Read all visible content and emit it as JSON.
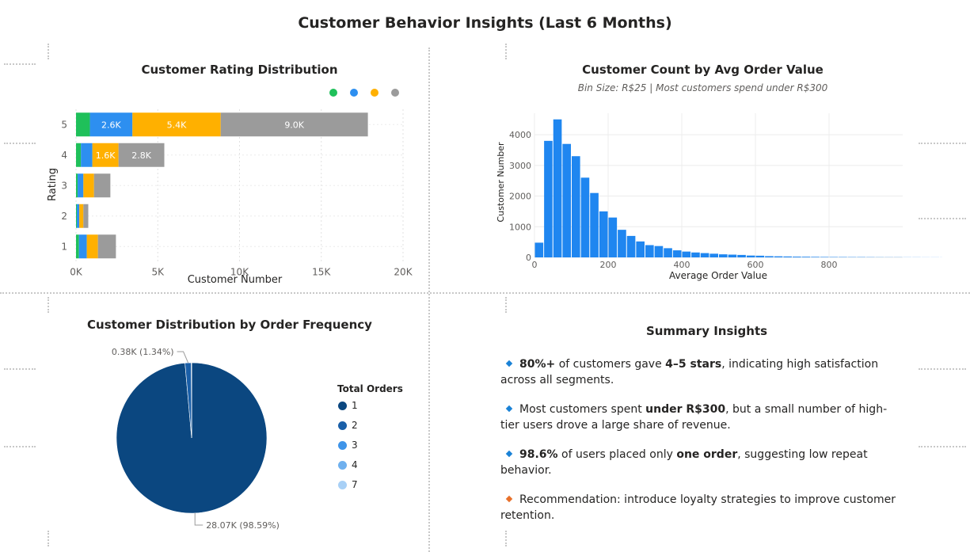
{
  "page": {
    "title": "Customer Behavior Insights (Last 6 Months)"
  },
  "rating_chart": {
    "title": "Customer Rating Distribution",
    "xlabel": "Customer Number",
    "ylabel": "Rating",
    "legend_colors": [
      "#1fc05a",
      "#2d8ff0",
      "#ffb000",
      "#9b9b9b"
    ]
  },
  "histogram": {
    "title": "Customer Count by Avg Order Value",
    "subtitle": "Bin Size: R$25 | Most customers spend under R$300",
    "xlabel": "Average Order Value",
    "ylabel": "Customer Number"
  },
  "pie_chart": {
    "title": "Customer Distribution by Order Frequency",
    "legend_title": "Total Orders",
    "legend": [
      {
        "label": "1",
        "color": "#0b4780"
      },
      {
        "label": "2",
        "color": "#1a5fa8"
      },
      {
        "label": "3",
        "color": "#3f94e8"
      },
      {
        "label": "4",
        "color": "#6fb0ee"
      },
      {
        "label": "7",
        "color": "#a8d0f6"
      }
    ],
    "label_small": "0.38K (1.34%)",
    "label_large": "28.07K (98.59%)"
  },
  "summary": {
    "title": "Summary Insights",
    "insights": [
      {
        "color": "#1a82d6",
        "parts": [
          {
            "t": "80%+",
            "b": true
          },
          {
            "t": " of customers gave ",
            "b": false
          },
          {
            "t": "4–5 stars",
            "b": true
          },
          {
            "t": ", indicating high satisfaction across all segments.",
            "b": false
          }
        ]
      },
      {
        "color": "#1a82d6",
        "parts": [
          {
            "t": "Most customers spent ",
            "b": false
          },
          {
            "t": "under R$300",
            "b": true
          },
          {
            "t": ", but a small number of high-tier users drove a large share of revenue.",
            "b": false
          }
        ]
      },
      {
        "color": "#1a82d6",
        "parts": [
          {
            "t": "98.6%",
            "b": true
          },
          {
            "t": " of users placed only ",
            "b": false
          },
          {
            "t": "one order",
            "b": true
          },
          {
            "t": ", suggesting low repeat behavior.",
            "b": false
          }
        ]
      },
      {
        "color": "#e8702a",
        "parts": [
          {
            "t": "Recommendation: introduce loyalty strategies to improve customer retention.",
            "b": false
          }
        ]
      }
    ]
  },
  "chart_data": [
    {
      "type": "bar",
      "orientation": "horizontal",
      "stacked": true,
      "title": "Customer Rating Distribution",
      "xlabel": "Customer Number",
      "ylabel": "Rating",
      "categories": [
        "5",
        "4",
        "3",
        "2",
        "1"
      ],
      "xlim": [
        0,
        20000
      ],
      "xticks": [
        {
          "value": 0,
          "label": "0K"
        },
        {
          "value": 5000,
          "label": "5K"
        },
        {
          "value": 10000,
          "label": "10K"
        },
        {
          "value": 15000,
          "label": "15K"
        },
        {
          "value": 20000,
          "label": "20K"
        }
      ],
      "series": [
        {
          "color": "#1fc05a",
          "values": [
            850,
            300,
            100,
            50,
            180
          ]
        },
        {
          "color": "#2d8ff0",
          "values": [
            2600,
            700,
            350,
            150,
            480
          ]
        },
        {
          "color": "#ffb000",
          "values": [
            5400,
            1600,
            650,
            250,
            680
          ]
        },
        {
          "color": "#9b9b9b",
          "values": [
            9000,
            2800,
            1000,
            300,
            1100
          ]
        }
      ],
      "data_labels": [
        [
          "",
          "2.6K",
          "5.4K",
          "9.0K"
        ],
        [
          "",
          "",
          "1.6K",
          "2.8K"
        ],
        [
          "",
          "",
          "",
          ""
        ],
        [
          "",
          "",
          "",
          ""
        ],
        [
          "",
          "",
          "",
          ""
        ]
      ],
      "grid": true,
      "legend": "top-right"
    },
    {
      "type": "bar",
      "subtype": "histogram",
      "title": "Customer Count by Avg Order Value",
      "xlabel": "Average Order Value",
      "ylabel": "Customer Number",
      "bin_size": 25,
      "bin_start": 0,
      "counts": [
        480,
        3800,
        4500,
        3700,
        3300,
        2600,
        2100,
        1500,
        1300,
        900,
        700,
        520,
        400,
        370,
        300,
        230,
        190,
        160,
        140,
        120,
        100,
        90,
        80,
        60,
        55,
        40,
        35,
        30,
        25,
        22,
        18,
        15,
        13,
        12,
        10,
        10,
        8,
        6,
        5,
        5,
        4,
        4,
        3,
        3,
        2,
        2
      ],
      "color": "#1f86f0",
      "xlim": [
        0,
        1000
      ],
      "ylim": [
        0,
        4700
      ],
      "xticks": [
        0,
        200,
        400,
        600,
        800
      ],
      "yticks": [
        0,
        1000,
        2000,
        3000,
        4000
      ],
      "grid": true
    },
    {
      "type": "pie",
      "title": "Customer Distribution by Order Frequency",
      "legend_title": "Total Orders",
      "slices": [
        {
          "label": "1",
          "value": 28070,
          "percent": 98.59,
          "color": "#0b4780",
          "data_label": "28.07K (98.59%)"
        },
        {
          "label": "2",
          "value": 380,
          "percent": 1.34,
          "color": "#1a5fa8",
          "data_label": "0.38K (1.34%)"
        },
        {
          "label": "3",
          "value": 15,
          "percent": 0.05,
          "color": "#3f94e8",
          "data_label": ""
        },
        {
          "label": "4",
          "value": 5,
          "percent": 0.02,
          "color": "#6fb0ee",
          "data_label": ""
        },
        {
          "label": "7",
          "value": 1,
          "percent": 0.0,
          "color": "#a8d0f6",
          "data_label": ""
        }
      ],
      "legend": "right"
    }
  ]
}
